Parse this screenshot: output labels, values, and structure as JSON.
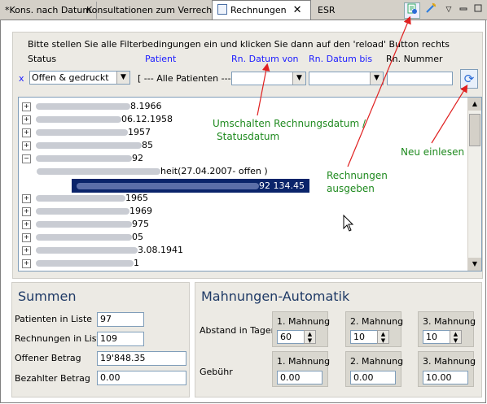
{
  "tabs": [
    {
      "label": "*Kons. nach Datum"
    },
    {
      "label": "Konsultationen zum Verrechnen"
    },
    {
      "label": "Rechnungen"
    },
    {
      "label": "ESR"
    }
  ],
  "filter": {
    "instruction": "Bitte stellen Sie alle Filterbedingungen ein und klicken Sie dann auf den 'reload' Button rechts",
    "status_label": "Status",
    "patient_label": "Patient",
    "date_from_label": "Rn. Datum von",
    "date_to_label": "Rn. Datum bis",
    "number_label": "Rn. Nummer",
    "clear_x": "x",
    "status_value": "Offen & gedruckt",
    "patient_value": "[ --- Alle Patienten --- ]",
    "date_from_value": "",
    "date_to_value": "",
    "number_value": ""
  },
  "tree": {
    "rows": [
      {
        "text": "8.1966"
      },
      {
        "text": "06.12.1958"
      },
      {
        "text": "1957"
      },
      {
        "text": "85"
      },
      {
        "text": "92"
      },
      {
        "text": "heit(27.04.2007- offen )"
      },
      {
        "text": "92 134.45"
      },
      {
        "text": "1965"
      },
      {
        "text": "1969"
      },
      {
        "text": "975"
      },
      {
        "text": "05"
      },
      {
        "text": "3.08.1941"
      },
      {
        "text": "1"
      }
    ]
  },
  "annotations": {
    "toggle_line1": "Umschalten Rechnungsdatum /",
    "toggle_line2": "Statusdatum",
    "output_line1": "Rechnungen",
    "output_line2": "ausgeben",
    "reload_note": "Neu einlesen"
  },
  "summen": {
    "title": "Summen",
    "rows": [
      {
        "label": "Patienten in Liste",
        "value": "97"
      },
      {
        "label": "Rechnungen in Liste",
        "value": "109"
      },
      {
        "label": "Offener Betrag",
        "value": "19'848.35"
      },
      {
        "label": "Bezahlter Betrag",
        "value": "0.00"
      }
    ]
  },
  "mahnungen": {
    "title": "Mahnungen-Automatik",
    "abstand_label": "Abstand in Tagen",
    "gebuehr_label": "Gebühr",
    "abstand": [
      {
        "label": "1. Mahnung",
        "value": "60"
      },
      {
        "label": "2. Mahnung",
        "value": "10"
      },
      {
        "label": "3. Mahnung",
        "value": "10"
      }
    ],
    "gebuehr": [
      {
        "label": "1. Mahnung",
        "value": "0.00"
      },
      {
        "label": "2. Mahnung",
        "value": "0.00"
      },
      {
        "label": "3. Mahnung",
        "value": "10.00"
      }
    ]
  },
  "colors": {
    "annotation": "#1f8a1f",
    "arrow": "#e02020",
    "selection": "#0a246a",
    "label_blue": "#1a1aff"
  }
}
